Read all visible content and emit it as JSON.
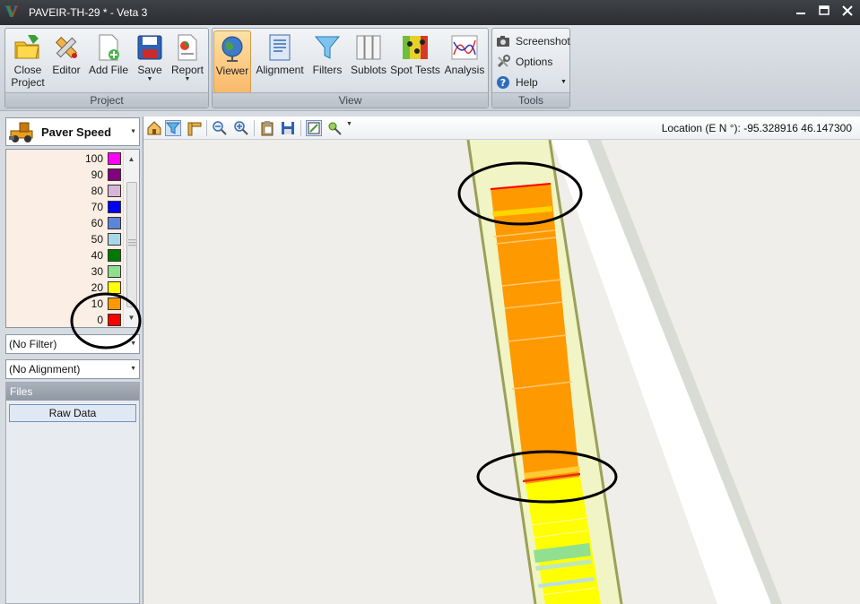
{
  "window": {
    "title": "PAVEIR-TH-29 * - Veta 3",
    "logo_letter": "V",
    "controls": {
      "minimize": "🗕",
      "maximize": "🗖",
      "close": "✕"
    }
  },
  "ribbon": {
    "groups": [
      {
        "label": "Project",
        "buttons": [
          {
            "name": "close-project",
            "label": "Close Project",
            "icon": "folder-arrow-icon"
          },
          {
            "name": "editor",
            "label": "Editor",
            "icon": "pencil-ruler-icon"
          },
          {
            "name": "add-file",
            "label": "Add File",
            "icon": "document-add-icon"
          },
          {
            "name": "save",
            "label": "Save",
            "icon": "floppy-disk-icon",
            "dropdown": true
          },
          {
            "name": "report",
            "label": "Report",
            "icon": "report-chart-icon",
            "dropdown": true
          }
        ]
      },
      {
        "label": "View",
        "buttons": [
          {
            "name": "viewer",
            "label": "Viewer",
            "icon": "globe-icon",
            "active": true
          },
          {
            "name": "alignment",
            "label": "Alignment",
            "icon": "document-icon"
          },
          {
            "name": "filters",
            "label": "Filters",
            "icon": "funnel-icon"
          },
          {
            "name": "sublots",
            "label": "Sublots",
            "icon": "columns-icon"
          },
          {
            "name": "spot-tests",
            "label": "Spot Tests",
            "icon": "heatmap-icon"
          },
          {
            "name": "analysis",
            "label": "Analysis",
            "icon": "line-chart-icon"
          }
        ]
      },
      {
        "label": "Tools",
        "buttons": [
          {
            "name": "screenshot",
            "label": "Screenshot",
            "icon": "camera-icon"
          },
          {
            "name": "options",
            "label": "Options",
            "icon": "tools-icon"
          },
          {
            "name": "help",
            "label": "Help",
            "icon": "question-icon",
            "dropdown": true
          }
        ]
      }
    ],
    "dropdown_glyph": "▼"
  },
  "left_panel": {
    "layer": {
      "name": "Paver Speed",
      "icon": "paver-icon"
    },
    "legend": [
      {
        "value": "100",
        "color": "#ff00ff"
      },
      {
        "value": "90",
        "color": "#800080"
      },
      {
        "value": "80",
        "color": "#d8b4d8"
      },
      {
        "value": "70",
        "color": "#0000ff"
      },
      {
        "value": "60",
        "color": "#5b85d8"
      },
      {
        "value": "50",
        "color": "#a8d8e8"
      },
      {
        "value": "40",
        "color": "#007a00"
      },
      {
        "value": "30",
        "color": "#8ee08e"
      },
      {
        "value": "20",
        "color": "#ffff00"
      },
      {
        "value": "10",
        "color": "#ff9900"
      },
      {
        "value": "0",
        "color": "#ff0000"
      }
    ],
    "filter_value": "(No Filter)",
    "alignment_value": "(No Alignment)",
    "files_header": "Files",
    "files": [
      "Raw Data"
    ]
  },
  "viewer": {
    "location_text": "Location (E N °): -95.328916 46.147300",
    "toolbar_icons": [
      "home-icon",
      "filter-icon",
      "ruler-icon",
      "zoom-out-icon",
      "zoom-in-icon",
      "clipboard-icon",
      "save-image-icon",
      "map-layer-icon",
      "marker-tool-icon"
    ],
    "colors": {
      "road_fill": "#f1f4c4",
      "paver_orange": "#ff9900",
      "paver_yellow": "#ffff00",
      "paver_red": "#ff0000",
      "green_band": "#90e090",
      "road_edge": "#9aa05c",
      "shoulder": "#d9dbd5"
    }
  }
}
